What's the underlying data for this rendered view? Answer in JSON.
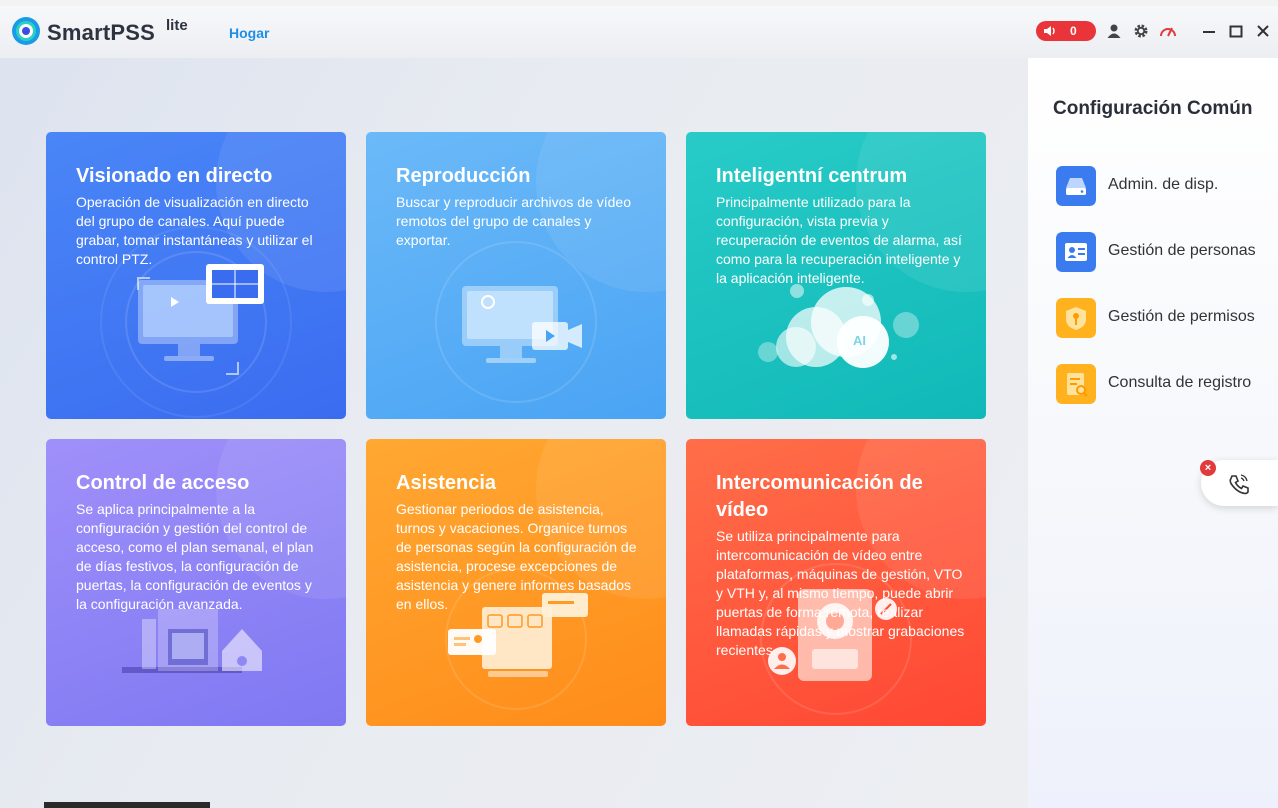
{
  "app": {
    "name": "SmartPSS",
    "edition": "lite",
    "nav_home": "Hogar",
    "alarm_count": "0"
  },
  "cards": [
    {
      "title": "Visionado en directo",
      "desc": "Operación de visualización en directo del grupo de canales. Aquí puede grabar, tomar instantáneas y utilizar el control PTZ."
    },
    {
      "title": "Reproducción",
      "desc": "Buscar y reproducir archivos de vídeo remotos del grupo de canales y exportar."
    },
    {
      "title": "Inteligentní centrum",
      "desc": "Principalmente utilizado para la configuración, vista previa y recuperación de eventos de alarma, así como para la recuperación inteligente y la aplicación inteligente."
    },
    {
      "title": "Control de acceso",
      "desc": "Se aplica principalmente a la configuración y gestión del control de acceso, como el plan semanal, el plan de días festivos, la configuración de puertas, la configuración de eventos y la configuración avanzada."
    },
    {
      "title": "Asistencia",
      "desc": "Gestionar periodos de asistencia, turnos y vacaciones. Organice turnos de personas según la configuración de asistencia, procese excepciones de asistencia y genere informes basados en ellos."
    },
    {
      "title": "Intercomunicación de vídeo",
      "desc": "Se utiliza principalmente para intercomunicación de vídeo entre plataformas, máquinas de gestión, VTO y VTH y, al mismo tiempo, puede abrir puertas de forma remota, realizar llamadas rápidas y mostrar grabaciones recientes."
    }
  ],
  "illustration_labels": {
    "ai_badge": "AI"
  },
  "common_config": {
    "title": "Configuración Común",
    "items": [
      {
        "label": "Admin. de disp.",
        "icon": "device-icon"
      },
      {
        "label": "Gestión de personas",
        "icon": "person-card-icon"
      },
      {
        "label": "Gestión de permisos",
        "icon": "shield-key-icon"
      },
      {
        "label": "Consulta de registro",
        "icon": "log-search-icon"
      }
    ]
  },
  "call_widget": {
    "close_glyph": "×"
  },
  "colors": {
    "accent": "#1f8fe6",
    "alarm": "#e9353a",
    "card_live": "#3d6ff0",
    "card_playback": "#5aaff6",
    "card_ai": "#1ec0c0",
    "card_access": "#8a7ff6",
    "card_attendance": "#ff9a23",
    "card_intercom": "#ff5a3a"
  }
}
